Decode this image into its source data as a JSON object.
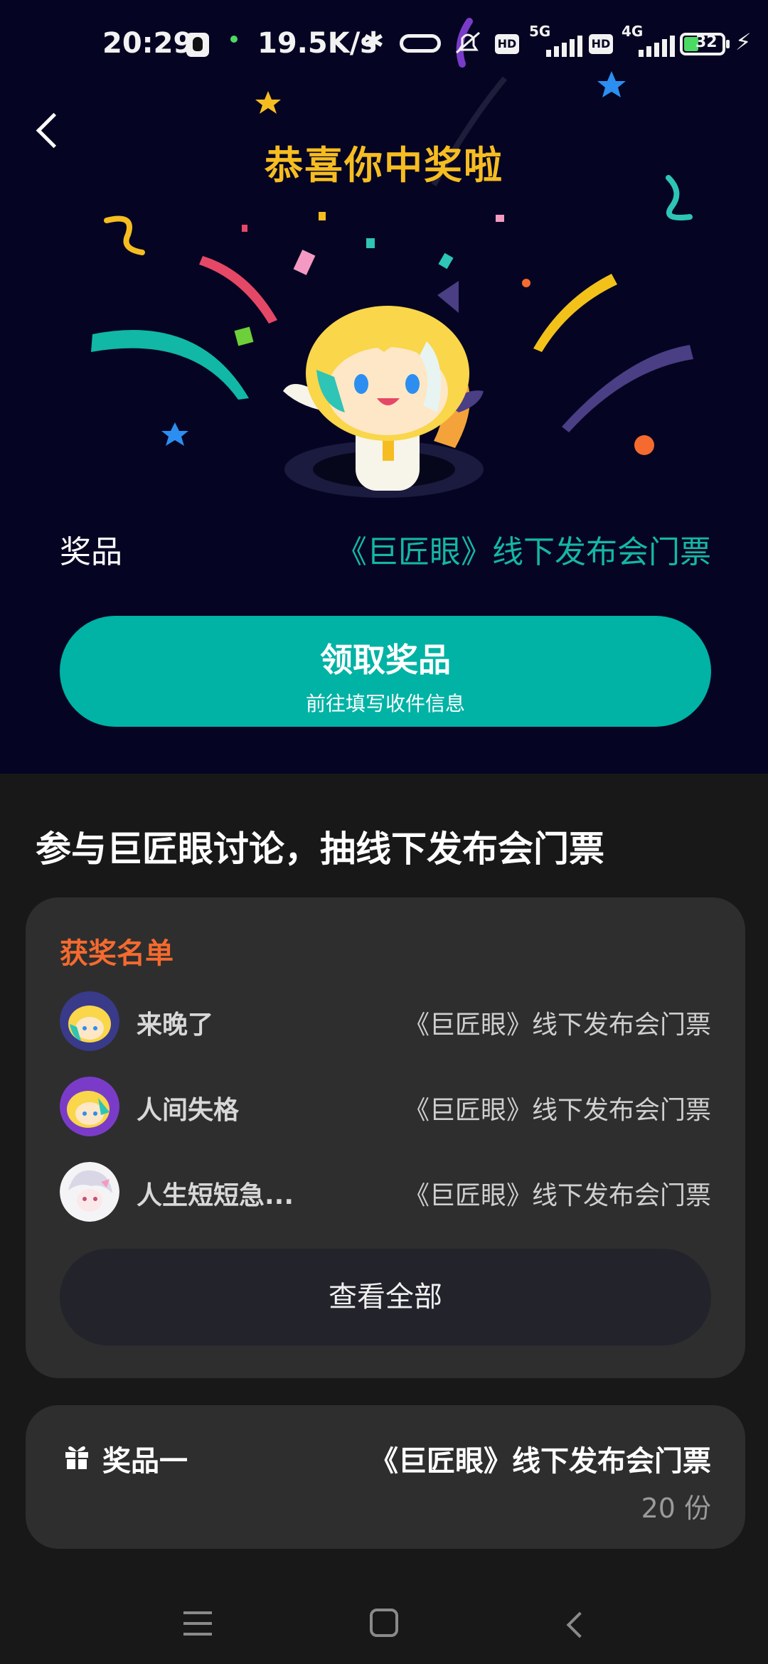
{
  "status_bar": {
    "time": "20:29",
    "network_speed": "19.5K/s",
    "hd_label": "HD",
    "sim1_type": "5G",
    "sim2_type": "4G",
    "battery": "32"
  },
  "header": {
    "title": "恭喜你中奖啦"
  },
  "prize_info": {
    "label": "奖品",
    "name": "《巨匠眼》线下发布会门票"
  },
  "claim_button": {
    "title": "领取奖品",
    "subtitle": "前往填写收件信息"
  },
  "event": {
    "title": "参与巨匠眼讨论，抽线下发布会门票"
  },
  "winners": {
    "heading": "获奖名单",
    "items": [
      {
        "name": "来晚了",
        "prize": "《巨匠眼》线下发布会门票"
      },
      {
        "name": "人间失格",
        "prize": "《巨匠眼》线下发布会门票"
      },
      {
        "name": "人生短短急...",
        "prize": "《巨匠眼》线下发布会门票"
      }
    ],
    "view_all_label": "查看全部"
  },
  "prize_card": {
    "label": "奖品一",
    "name": "《巨匠眼》线下发布会门票",
    "count": "20 份"
  },
  "colors": {
    "accent_teal": "#00b3a5",
    "title_gold": "#f6bd21",
    "winners_orange": "#f56a2f",
    "top_background": "#050523",
    "page_background": "#181818",
    "card_background": "#2e2e2e"
  }
}
